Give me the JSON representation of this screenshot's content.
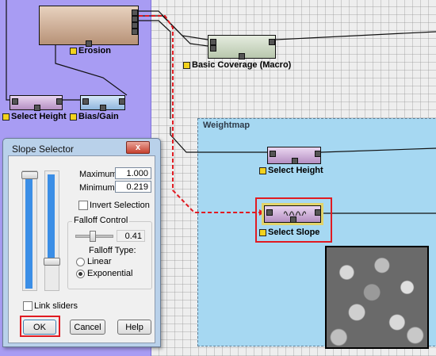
{
  "colors": {
    "group_blue": "#a89cf3",
    "group_weightmap": "#a6d8f2",
    "highlight_red": "#e01b22",
    "label_square": "#f2d21d",
    "slider_fill": "#3b8ee6"
  },
  "groups": {
    "weightmap_title": "Weightmap"
  },
  "nodes": {
    "erosion": "Erosion",
    "basic_coverage": "Basic Coverage (Macro)",
    "select_height_top": "Select Height",
    "bias_gain": "Bias/Gain",
    "select_height_weightmap": "Select Height",
    "select_slope": "Select Slope"
  },
  "dialog": {
    "title": "Slope Selector",
    "close_glyph": "x",
    "maximum_label": "Maximum:",
    "maximum_value": "1.000",
    "minimum_label": "Minimum:",
    "minimum_value": "0.219",
    "invert_selection": "Invert Selection",
    "falloff_control": "Falloff Control",
    "falloff_value": "0.41",
    "falloff_type": "Falloff Type:",
    "linear": "Linear",
    "exponential": "Exponential",
    "link_sliders": "Link sliders",
    "ok": "OK",
    "cancel": "Cancel",
    "help": "Help",
    "max_slider_level": 1.0,
    "min_slider_level": 0.219,
    "falloff_level": 0.41
  },
  "icons": {
    "port": "port-icon",
    "label_marker": "yellow-square-icon",
    "slope_wave": "wave-icon"
  }
}
